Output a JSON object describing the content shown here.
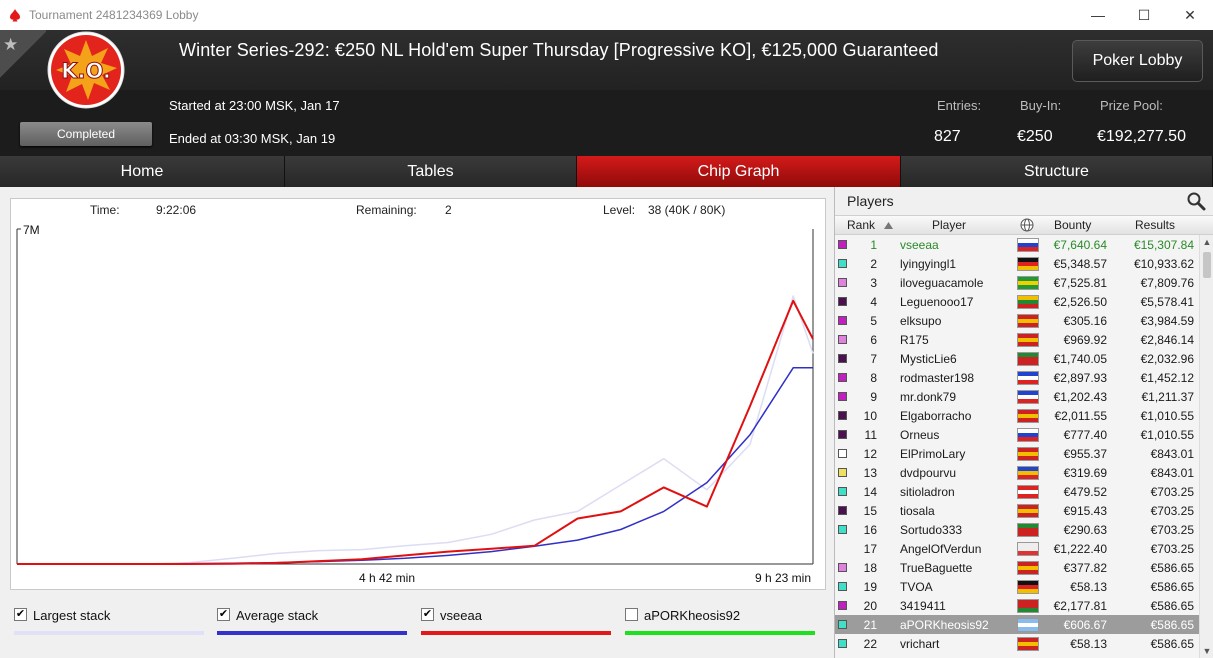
{
  "window": {
    "title": "Tournament 2481234369 Lobby",
    "minimize": "—",
    "maximize": "☐",
    "close": "✕"
  },
  "header": {
    "star": "★",
    "ko_text": "K.O.",
    "title": "Winter Series-292: €250 NL Hold'em Super Thursday [Progressive KO], €125,000 Guaranteed",
    "poker_lobby": "Poker Lobby",
    "status": "Completed",
    "started": "Started at 23:00 MSK, Jan 17",
    "ended": "Ended at 03:30 MSK, Jan 19",
    "entries_label": "Entries:",
    "entries_value": "827",
    "buyin_label": "Buy-In:",
    "buyin_value": "€250",
    "prizepool_label": "Prize Pool:",
    "prizepool_value": "€192,277.50"
  },
  "tabs": [
    {
      "label": "Home"
    },
    {
      "label": "Tables"
    },
    {
      "label": "Chip Graph"
    },
    {
      "label": "Structure"
    }
  ],
  "chart_info": {
    "time_label": "Time:",
    "time_value": "9:22:06",
    "remaining_label": "Remaining:",
    "remaining_value": "2",
    "level_label": "Level:",
    "level_value": "38 (40K / 80K)"
  },
  "chart_data": {
    "type": "line",
    "ylim": [
      0,
      7000000
    ],
    "y_tick_label": "7M",
    "x_tick_labels": [
      "4 h 42 min",
      "9 h 23 min"
    ],
    "x": [
      0,
      0.5,
      1,
      1.5,
      2,
      2.5,
      3,
      3.5,
      4,
      4.5,
      5,
      5.5,
      6,
      6.5,
      7,
      7.5,
      8,
      8.5,
      9,
      9.23
    ],
    "series": [
      {
        "name": "Largest stack",
        "color": "#dcdcf4",
        "values": [
          0,
          0,
          0,
          0,
          30000,
          120000,
          220000,
          280000,
          300000,
          380000,
          450000,
          620000,
          920000,
          1100000,
          1650000,
          2200000,
          1550000,
          2500000,
          5600000,
          4400000
        ]
      },
      {
        "name": "Average stack",
        "color": "#3030c8",
        "values": [
          0,
          0,
          0,
          0,
          8000,
          15000,
          30000,
          50000,
          80000,
          120000,
          180000,
          260000,
          370000,
          500000,
          720000,
          1100000,
          1700000,
          2700000,
          4100000,
          4100000
        ]
      },
      {
        "name": "vseeaa",
        "color": "#e01010",
        "values": [
          0,
          0,
          0,
          0,
          0,
          5000,
          20000,
          60000,
          100000,
          180000,
          260000,
          320000,
          380000,
          950000,
          1100000,
          1600000,
          1200000,
          3300000,
          5500000,
          4700000
        ]
      },
      {
        "name": "aPORKheosis92",
        "color": "#22dd22",
        "values": []
      }
    ]
  },
  "legend": [
    {
      "label": "Largest stack",
      "checked": "✔",
      "color": "#e0e0f6"
    },
    {
      "label": "Average stack",
      "checked": "✔",
      "color": "#3333cc"
    },
    {
      "label": "vseeaa",
      "checked": "✔",
      "color": "#e31818"
    },
    {
      "label": "aPORKheosis92",
      "checked": "",
      "color": "#1ee01e"
    }
  ],
  "players": {
    "title": "Players",
    "columns": {
      "rank": "Rank",
      "player": "Player",
      "bounty": "Bounty",
      "results": "Results"
    },
    "rows": [
      {
        "rank": "1",
        "name": "vseeaa",
        "bounty": "€7,640.64",
        "result": "€15,307.84",
        "swatch": "#c020c0",
        "flag": [
          "#ffffff",
          "#2244cc",
          "#dd2222"
        ]
      },
      {
        "rank": "2",
        "name": "lyingyingl1",
        "bounty": "€5,348.57",
        "result": "€10,933.62",
        "swatch": "#40e0c8",
        "flag": [
          "#111111",
          "#dd2222",
          "#f0c000"
        ]
      },
      {
        "rank": "3",
        "name": "iloveguacamole",
        "bounty": "€7,525.81",
        "result": "€7,809.76",
        "swatch": "#e080e0",
        "flag": [
          "#229933",
          "#f0d000",
          "#229933"
        ]
      },
      {
        "rank": "4",
        "name": "Leguenooo17",
        "bounty": "€2,526.50",
        "result": "€5,578.41",
        "swatch": "#4a1050",
        "flag": [
          "#f0c000",
          "#228833",
          "#cc2222"
        ]
      },
      {
        "rank": "5",
        "name": "elksupo",
        "bounty": "€305.16",
        "result": "€3,984.59",
        "swatch": "#c020c0",
        "flag": [
          "#cc2222",
          "#f0c000",
          "#cc2222"
        ]
      },
      {
        "rank": "6",
        "name": "R175",
        "bounty": "€969.92",
        "result": "€2,846.14",
        "swatch": "#e080e0",
        "flag": [
          "#cc2222",
          "#f0c000",
          "#cc2222"
        ]
      },
      {
        "rank": "7",
        "name": "MysticLie6",
        "bounty": "€1,740.05",
        "result": "€2,032.96",
        "swatch": "#4a1050",
        "flag": [
          "#228833",
          "#cc2222",
          "#cc2222"
        ]
      },
      {
        "rank": "8",
        "name": "rodmaster198",
        "bounty": "€2,897.93",
        "result": "€1,452.12",
        "swatch": "#c020c0",
        "flag": [
          "#2244cc",
          "#ffffff",
          "#dd2222"
        ]
      },
      {
        "rank": "9",
        "name": "mr.donk79",
        "bounty": "€1,202.43",
        "result": "€1,211.37",
        "swatch": "#c020c0",
        "flag": [
          "#2244cc",
          "#ffffff",
          "#dd2222"
        ]
      },
      {
        "rank": "10",
        "name": "Elgaborracho",
        "bounty": "€2,011.55",
        "result": "€1,010.55",
        "swatch": "#4a1050",
        "flag": [
          "#cc2222",
          "#f0c000",
          "#cc2222"
        ]
      },
      {
        "rank": "11",
        "name": "Orneus",
        "bounty": "€777.40",
        "result": "€1,010.55",
        "swatch": "#4a1050",
        "flag": [
          "#ffffff",
          "#2244cc",
          "#dd2222"
        ]
      },
      {
        "rank": "12",
        "name": "ElPrimoLary",
        "bounty": "€955.37",
        "result": "€843.01",
        "swatch": "#ffffff",
        "flag": [
          "#cc2222",
          "#f0c000",
          "#cc2222"
        ]
      },
      {
        "rank": "13",
        "name": "dvdpourvu",
        "bounty": "€319.69",
        "result": "€843.01",
        "swatch": "#f0e060",
        "flag": [
          "#2244cc",
          "#f0c000",
          "#dd2222"
        ]
      },
      {
        "rank": "14",
        "name": "sitioladron",
        "bounty": "€479.52",
        "result": "€703.25",
        "swatch": "#40e0c8",
        "flag": [
          "#dd2222",
          "#ffffff",
          "#dd2222"
        ]
      },
      {
        "rank": "15",
        "name": "tiosala",
        "bounty": "€915.43",
        "result": "€703.25",
        "swatch": "#4a1050",
        "flag": [
          "#cc2222",
          "#f0c000",
          "#cc2222"
        ]
      },
      {
        "rank": "16",
        "name": "Sortudo333",
        "bounty": "€290.63",
        "result": "€703.25",
        "swatch": "#40e0c8",
        "flag": [
          "#228833",
          "#cc2222",
          "#cc2222"
        ]
      },
      {
        "rank": "17",
        "name": "AngelOfVerdun",
        "bounty": "€1,222.40",
        "result": "€703.25",
        "swatch": "",
        "flag": [
          "#eeeeee",
          "#eeeeee",
          "#dd3333"
        ]
      },
      {
        "rank": "18",
        "name": "TrueBaguette",
        "bounty": "€377.82",
        "result": "€586.65",
        "swatch": "#e080e0",
        "flag": [
          "#cc2222",
          "#f0c000",
          "#cc2222"
        ]
      },
      {
        "rank": "19",
        "name": "TVOA",
        "bounty": "€58.13",
        "result": "€586.65",
        "swatch": "#40e0c8",
        "flag": [
          "#111111",
          "#dd2222",
          "#f0c000"
        ]
      },
      {
        "rank": "20",
        "name": "3419411",
        "bounty": "€2,177.81",
        "result": "€586.65",
        "swatch": "#c020c0",
        "flag": [
          "#cc2222",
          "#cc2222",
          "#228833"
        ]
      },
      {
        "rank": "21",
        "name": "aPORKheosis92",
        "bounty": "€606.67",
        "result": "€586.65",
        "swatch": "#40e0c8",
        "flag": [
          "#88bbee",
          "#ffffff",
          "#88bbee"
        ],
        "selected": true
      },
      {
        "rank": "22",
        "name": "vrichart",
        "bounty": "€58.13",
        "result": "€586.65",
        "swatch": "#40e0c8",
        "flag": [
          "#cc2222",
          "#f0c000",
          "#cc2222"
        ]
      }
    ]
  },
  "icons": {
    "pokerstars": "pokerstars-logo-icon",
    "search": "magnifier-icon",
    "globe": "globe-icon",
    "sort": "sort-up-icon"
  }
}
